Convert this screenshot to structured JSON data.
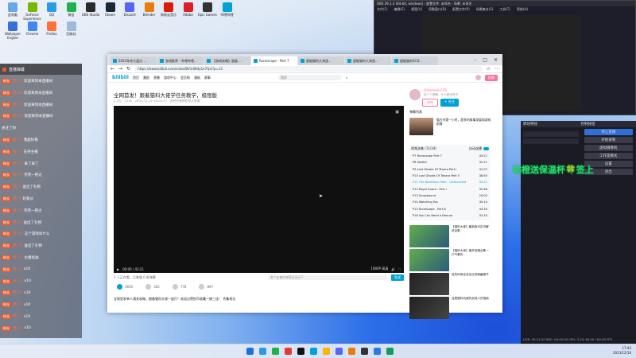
{
  "desktop_icons": [
    {
      "label": "此电脑",
      "color": "#6aa7e6"
    },
    {
      "label": "GeForce Experience",
      "color": "#76b900"
    },
    {
      "label": "QQ",
      "color": "#2b9be6"
    },
    {
      "label": "微信",
      "color": "#21b14c"
    },
    {
      "label": "OBS Studio",
      "color": "#2a2a2a"
    },
    {
      "label": "Steam",
      "color": "#1b2838"
    },
    {
      "label": "Discord",
      "color": "#5865f2"
    },
    {
      "label": "Blender",
      "color": "#e87d0d"
    },
    {
      "label": "网易云音乐",
      "color": "#d81e06"
    },
    {
      "label": "Adobe",
      "color": "#da1f26"
    },
    {
      "label": "Epic Games",
      "color": "#333"
    },
    {
      "label": "哔哩哔哩",
      "color": "#00a1d6"
    },
    {
      "label": "Wallpaper Engine",
      "color": "#3a6fd8"
    },
    {
      "label": "Chrome",
      "color": "#4285f4"
    },
    {
      "label": "Firefox",
      "color": "#ff7139"
    },
    {
      "label": "回收站",
      "color": "#9bbbd9"
    }
  ],
  "chat": {
    "title": "直播弹幕",
    "lines": [
      {
        "badge": "粉丝",
        "user": "用户A",
        "msg": "欢迎来到本直播间"
      },
      {
        "badge": "粉丝",
        "user": "用户B",
        "msg": "欢迎来到本直播间"
      },
      {
        "badge": "粉丝",
        "user": "用户C",
        "msg": "欢迎来到本直播间"
      },
      {
        "badge": "粉丝",
        "user": "用户D",
        "msg": "欢迎来到本直播间"
      },
      {
        "badge": "",
        "user": "",
        "msg": "关注了你"
      },
      {
        "badge": "粉丝",
        "user": "用户E",
        "msg": "我超好看"
      },
      {
        "badge": "粉丝",
        "user": "用户F",
        "msg": "支持主播"
      },
      {
        "badge": "粉丝",
        "user": "用户G",
        "msg": "来了来了"
      },
      {
        "badge": "粉丝",
        "user": "用户H",
        "msg": "笑死一把过"
      },
      {
        "badge": "粉丝",
        "user": "用户I",
        "msg": "送出了礼物"
      },
      {
        "badge": "粉丝",
        "user": "用户J",
        "msg": "好家伙"
      },
      {
        "badge": "粉丝",
        "user": "用户K",
        "msg": "笑死一把过"
      },
      {
        "badge": "粉丝",
        "user": "用户L",
        "msg": "送出了礼物"
      },
      {
        "badge": "粉丝",
        "user": "用户M",
        "msg": "这个游戏叫什么"
      },
      {
        "badge": "粉丝",
        "user": "用户N",
        "msg": "送出了礼物"
      },
      {
        "badge": "粉丝",
        "user": "用户O",
        "msg": "主播加油"
      },
      {
        "badge": "粉丝",
        "user": "用户P",
        "msg": "x10"
      },
      {
        "badge": "粉丝",
        "user": "用户Q",
        "msg": "x10"
      },
      {
        "badge": "粉丝",
        "user": "用户R",
        "msg": "x10"
      },
      {
        "badge": "粉丝",
        "user": "用户S",
        "msg": "x10"
      },
      {
        "badge": "粉丝",
        "user": "用户T",
        "msg": "x10"
      },
      {
        "badge": "粉丝",
        "user": "用户U",
        "msg": "x10"
      }
    ]
  },
  "obs": {
    "title": "OBS 29.1.3 (64-bit, windows) - 配置文件: 未命名 - 场景: 未命名",
    "menu": [
      "文件(F)",
      "编辑(E)",
      "视图(V)",
      "停靠窗口(D)",
      "配置文件(P)",
      "场景集合(S)",
      "工具(T)",
      "帮助(H)"
    ],
    "dock_titles": [
      "转场特效",
      "控制按钮"
    ],
    "buttons": [
      "停止直播",
      "开始录制",
      "虚拟摄像机",
      "工作室模式",
      "设置",
      "退出"
    ],
    "status": "LIVE: 00:11:20  REC: 00:00:00  CPU: 3.2%  60.00 / 60.00 FPS"
  },
  "overlay_text": "帖橙送保温杯🍀签上",
  "browser": {
    "tabs": [
      {
        "label": "2023年终大盘点 ...",
        "active": false
      },
      {
        "label": "游戏推荐 - 哔哩哔哩...",
        "active": false
      },
      {
        "label": "【游戏攻略】超级...",
        "active": false
      },
      {
        "label": "Runescape - Part 7",
        "active": true
      },
      {
        "label": "超能猫的大海里...",
        "active": false
      },
      {
        "label": "超能猫的大海里...",
        "active": false
      },
      {
        "label": "超能猫的SCD...",
        "active": false
      }
    ],
    "url": "https://www.bilibili.com/video/BV1dW4y1e7Qx/?p=11",
    "nav": [
      "首页",
      "番剧",
      "直播",
      "游戏中心",
      "会员购",
      "漫画",
      "赛事"
    ],
    "search_placeholder": "搜索",
    "upload": "投稿",
    "video_title": "全网首发！跟着猫科大佬学任务教学，极限版",
    "video_meta": "2.3万  ·  1240  ·  2023-12-15 18:00:27  ·  未经作者授权禁止转载",
    "player_time": "00:00 / 43:21",
    "player_quality": "1080P 高清",
    "danmaku_count": "1 人正在看，已装填 0 条弹幕",
    "danmaku_placeholder": "发个友善的弹幕见证当下",
    "danmaku_send": "发送",
    "actions": [
      {
        "label": "3692",
        "liked": true
      },
      {
        "label": "302",
        "liked": false
      },
      {
        "label": "778",
        "liked": false
      },
      {
        "label": "897",
        "liked": false
      }
    ],
    "description": "全网首发单人通关攻略，跟着猫科大佬一起打！欢迎点赞投币收藏一键三连！ 合集地址",
    "up_name": "Oldsmile-FPS",
    "up_sub": "这个人很懒，什么都没有写",
    "follow": "+ 关注",
    "charge": "充电",
    "related_header": "弹幕列表",
    "thumb1_title": "猫方舟第一小时，超多的故事发展和游戏剧情",
    "playlist": {
      "title": "视频选集 (11/34)",
      "toggle": "自动连播",
      "items": [
        {
          "label": "P7  Runescape Part 7",
          "time": "43:21",
          "current": false
        },
        {
          "label": "P8  Soldier",
          "time": "32:11",
          "current": false
        },
        {
          "label": "P9  Lost Ghosts Of Tenara Part I",
          "time": "41:07",
          "current": false
        },
        {
          "label": "P10  Lost Ghosts Of Tenara Part II",
          "time": "38:55",
          "current": false
        },
        {
          "label": "P11  The Northman Path - Unshackled",
          "time": "43:21",
          "current": true
        },
        {
          "label": "P12  Royal Guard - Part I",
          "time": "35:48",
          "current": false
        },
        {
          "label": "P13  Snowbound",
          "time": "29:02",
          "current": false
        },
        {
          "label": "P14  Watching You",
          "time": "40:14",
          "current": false
        },
        {
          "label": "P15  Runescape - Part 8",
          "time": "44:30",
          "current": false
        },
        {
          "label": "P16  You Can Need a Rescue",
          "time": "31:20",
          "current": false
        }
      ]
    },
    "recommend": [
      {
        "title": "【猫科大佬】最新版本实况解说全集",
        "dark": false
      },
      {
        "title": "【猫科大佬】通关攻略合集一口气看完",
        "dark": false
      },
      {
        "title": "这些你肯定没见过的隐藏细节",
        "dark": true
      },
      {
        "title": "这是猫科玩家的战地人员指南",
        "dark": true
      }
    ]
  },
  "taskbar": {
    "apps": [
      "#1f6fe0",
      "#2b9be6",
      "#21b14c",
      "#e03c31",
      "#111",
      "#00a1d6",
      "#ffb400",
      "#5865f2",
      "#e87d0d",
      "#333",
      "#2a7ae2",
      "#0f9d58"
    ],
    "time": "17:43",
    "date": "2023/12/16"
  }
}
